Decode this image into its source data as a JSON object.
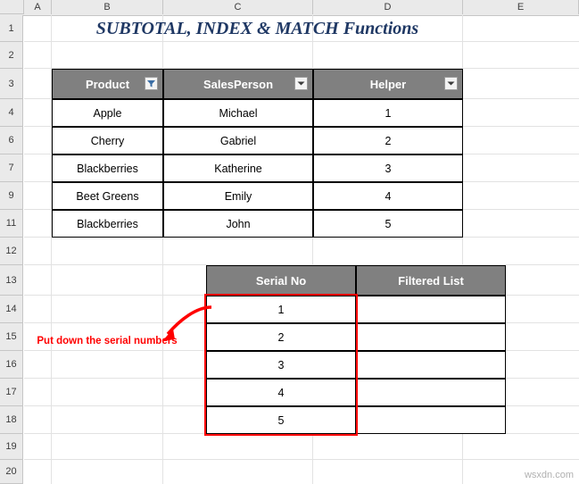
{
  "sheet": {
    "title": "SUBTOTAL, INDEX & MATCH Functions",
    "column_headers": [
      "A",
      "B",
      "C",
      "D",
      "E"
    ],
    "row_headers": [
      "1",
      "2",
      "3",
      "4",
      "6",
      "7",
      "9",
      "11",
      "12",
      "13",
      "14",
      "15",
      "16",
      "17",
      "18",
      "19",
      "20"
    ],
    "watermark": "wsxdn.com"
  },
  "table1": {
    "headers": [
      "Product",
      "SalesPerson",
      "Helper"
    ],
    "rows": [
      [
        "Apple",
        "Michael",
        "1"
      ],
      [
        "Cherry",
        "Gabriel",
        "2"
      ],
      [
        "Blackberries",
        "Katherine",
        "3"
      ],
      [
        "Beet Greens",
        "Emily",
        "4"
      ],
      [
        "Blackberries",
        "John",
        "5"
      ]
    ],
    "filter_icons": [
      "filter-applied-icon",
      "filter-dropdown-icon",
      "filter-dropdown-icon"
    ]
  },
  "table2": {
    "headers": [
      "Serial No",
      "Filtered List"
    ],
    "rows": [
      [
        "1",
        ""
      ],
      [
        "2",
        ""
      ],
      [
        "3",
        ""
      ],
      [
        "4",
        ""
      ],
      [
        "5",
        ""
      ]
    ]
  },
  "annotation": {
    "text": "Put down the serial numbers",
    "color": "#ff0000"
  }
}
